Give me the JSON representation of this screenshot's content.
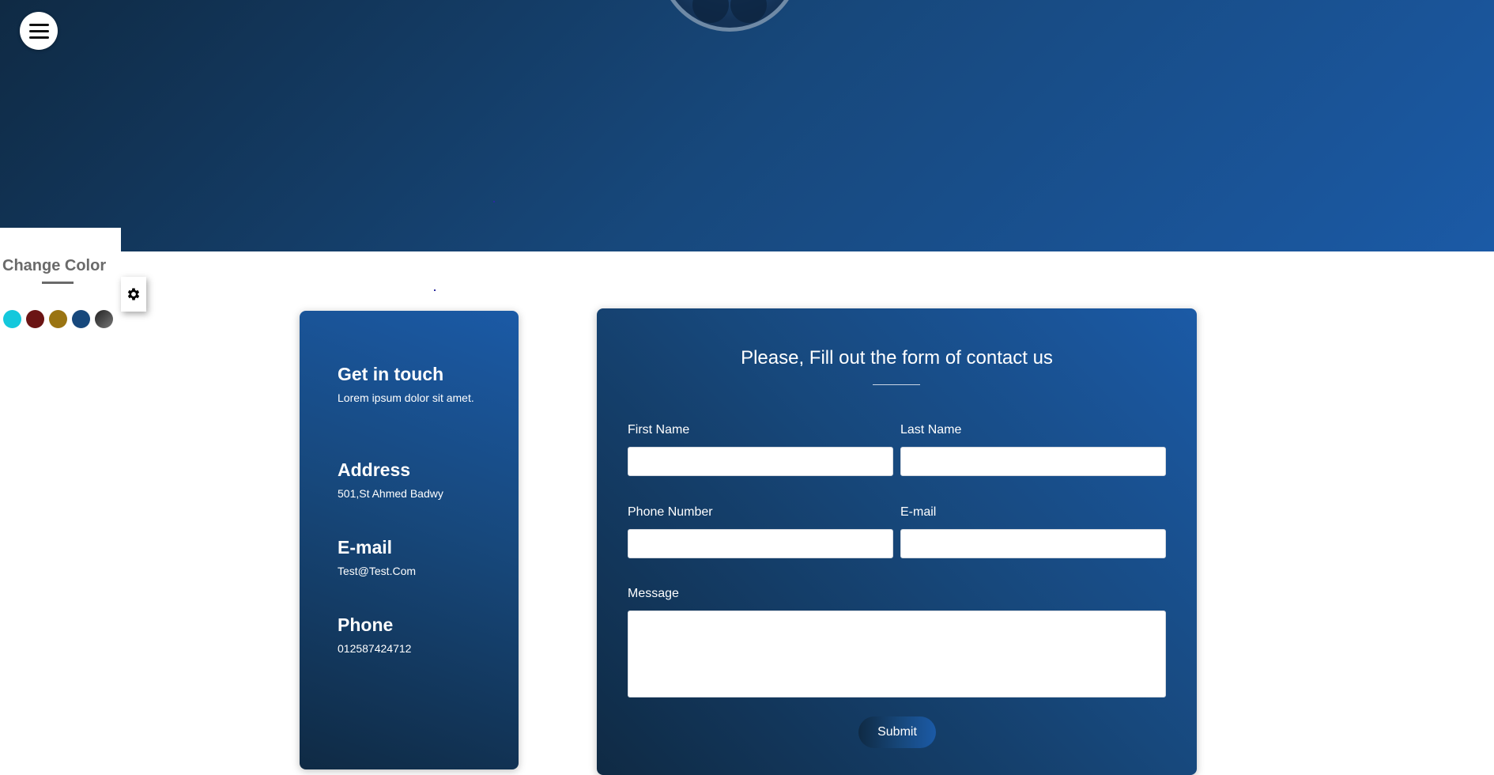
{
  "header": {
    "menu_icon": "hamburger-menu-icon"
  },
  "color_switcher": {
    "title": "Change Color",
    "settings_icon": "gear-icon",
    "swatches": [
      {
        "name": "cyan",
        "color": "#14c8dc"
      },
      {
        "name": "dark-red",
        "color": "#6b1414"
      },
      {
        "name": "gold",
        "color": "#9a7412"
      },
      {
        "name": "blue",
        "color": "#17487c"
      },
      {
        "name": "gray",
        "color": "#4a4a4a"
      }
    ]
  },
  "info": {
    "heading": "Get in touch",
    "subtext": "Lorem ipsum dolor sit amet.",
    "address_label": "Address",
    "address_value": "501,St Ahmed Badwy",
    "email_label": "E-mail",
    "email_value": "Test@Test.Com",
    "phone_label": "Phone",
    "phone_value": "012587424712"
  },
  "form": {
    "title": "Please, Fill out the form of contact us",
    "first_name_label": "First Name",
    "last_name_label": "Last Name",
    "phone_label": "Phone Number",
    "email_label": "E-mail",
    "message_label": "Message",
    "submit_label": "Submit"
  },
  "colors": {
    "primary_dark": "#0f2a44",
    "primary": "#17487c",
    "primary_light": "#1b5aa6"
  }
}
